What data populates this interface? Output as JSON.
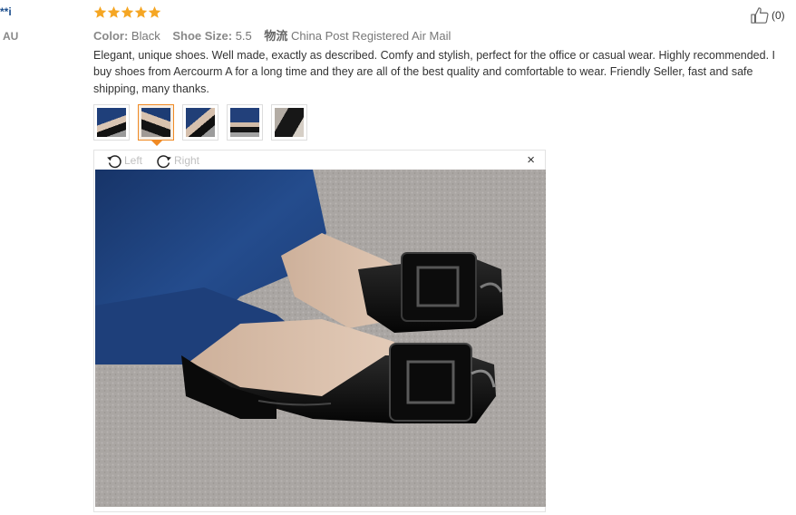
{
  "reviewer": {
    "name": "**i",
    "country": "AU"
  },
  "review": {
    "rating": 5,
    "max_rating": 5,
    "star_color": "#f5a623",
    "helpful_count": "(0)",
    "attributes": {
      "color_label": "Color:",
      "color_value": "Black",
      "size_label": "Shoe Size:",
      "size_value": "5.5",
      "shipping_label": "物流",
      "shipping_value": "China Post Registered Air Mail"
    },
    "text": "Elegant, unique shoes. Well made, exactly as described. Comfy and stylish, perfect for the office or casual wear. Highly recommended. I buy shoes from Aercourm A for a long time and they are all of the best quality and comfortable to wear. Friendly Seller, fast and safe shipping, many thanks.",
    "thumbnails": [
      {
        "icon": "shoe-photo-1",
        "active": false
      },
      {
        "icon": "shoe-photo-2",
        "active": true
      },
      {
        "icon": "shoe-photo-3",
        "active": false
      },
      {
        "icon": "shoe-photo-4",
        "active": false
      },
      {
        "icon": "shoe-photo-5",
        "active": false
      }
    ]
  },
  "viewer": {
    "rotate_left_label": "Left",
    "rotate_right_label": "Right",
    "close_label": "×",
    "accent_color": "#f08a24"
  }
}
